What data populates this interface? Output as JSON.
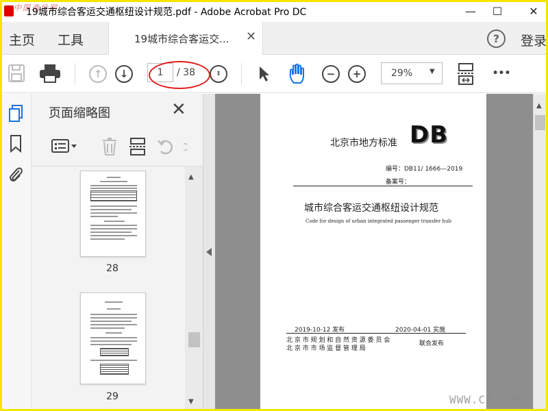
{
  "window": {
    "title": "19城市综合客运交通枢纽设计规范.pdf - Adobe Acrobat Pro DC",
    "watermark_top": "中国造价网",
    "minimize": "—",
    "maximize": "☐",
    "close": "✕"
  },
  "tabs": {
    "home": "主页",
    "tools": "工具",
    "document": "19城市综合客运交...",
    "document_close": "✕",
    "help": "?",
    "login": "登录"
  },
  "toolbar": {
    "current_page": "1",
    "total_pages": "/ 38",
    "zoom": "29%",
    "zoom_caret": "▼",
    "more": "•••"
  },
  "panel": {
    "title": "页面缩略图",
    "close": "✕",
    "thumbnails": [
      {
        "page": "28"
      },
      {
        "page": "29"
      }
    ]
  },
  "pdf": {
    "issuer": "北京市地方标准",
    "logo": "DB",
    "code": "编号：DB11/ 1666—2019",
    "record": "备案号：",
    "title_cn": "城市综合客运交通枢纽设计规范",
    "title_en": "Code for design of urban integrated passenger transfer hub",
    "published": "2019-10-12 发布",
    "effective": "2020-04-01 实施",
    "authority_1": "北 京 市 规 划 和 自 然 资 源 委 员 会",
    "authority_2": "北  京  市  市  场  监  督  管  理  局",
    "joint": "联合发布"
  },
  "watermark_bottom": "WWW.CR.COM",
  "colors": {
    "accent_blue": "#1473e6",
    "annotation_red": "#e21a1a",
    "frame_yellow": "#f5e600"
  }
}
